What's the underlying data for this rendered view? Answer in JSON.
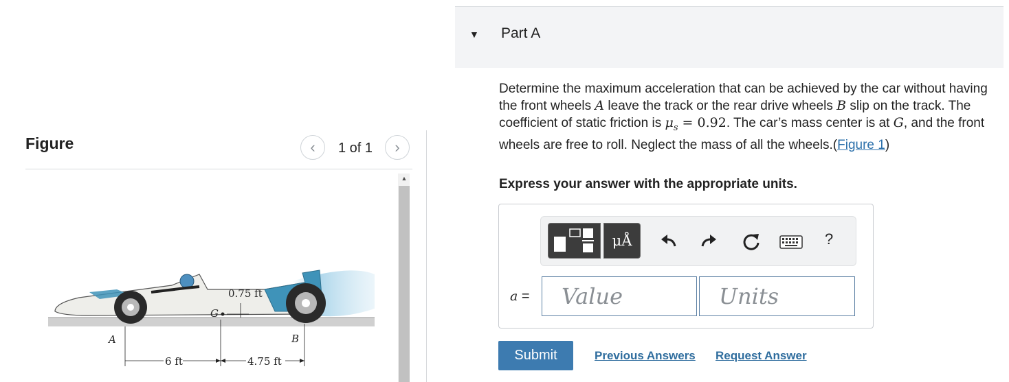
{
  "figure_panel": {
    "title": "Figure",
    "counter": "1 of 1",
    "prev_symbol": "‹",
    "next_symbol": "›",
    "figure_labels": {
      "offset": "0.75 ft",
      "mass_center": "G",
      "front_wheel": "A",
      "rear_wheel": "B",
      "dim_left": "6 ft",
      "dim_right": "4.75 ft"
    }
  },
  "part": {
    "title": "Part A",
    "problem_text": {
      "p1": "Determine the maximum acceleration that can be achieved by the car without having the front wheels ",
      "var_a": "A",
      "p2": " leave the track or the rear drive wheels ",
      "var_b": "B",
      "p3": " slip on the track. The coefficient of static friction is ",
      "mu": "μ",
      "mu_sub": "s",
      "equals": " = 0.92",
      "p4": ". The car’s mass center is at ",
      "var_g": "G",
      "p5": ", and the front wheels are free to roll. Neglect the mass of all the wheels.",
      "link_open": "(",
      "link": "Figure 1",
      "link_close": ")"
    },
    "instruction": "Express your answer with the appropriate units."
  },
  "answer": {
    "symbols_label": "μÅ",
    "help_label": "?",
    "variable": "a",
    "equals": " =",
    "value_placeholder": "Value",
    "units_placeholder": "Units"
  },
  "actions": {
    "submit": "Submit",
    "previous_answers": "Previous Answers",
    "request_answer": "Request Answer"
  }
}
